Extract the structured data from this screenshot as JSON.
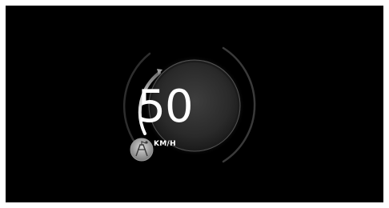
{
  "speedometer": {
    "speed": "50",
    "unit": "KM/H",
    "icon": "road-sign-icon"
  },
  "colors": {
    "screen_background": "#000000",
    "dial_dark": "#111111",
    "dial_light": "#4a4a4a",
    "progress_arc": "#d8d8d8",
    "track_arc": "#3a3a3a",
    "text": "#ffffff"
  }
}
